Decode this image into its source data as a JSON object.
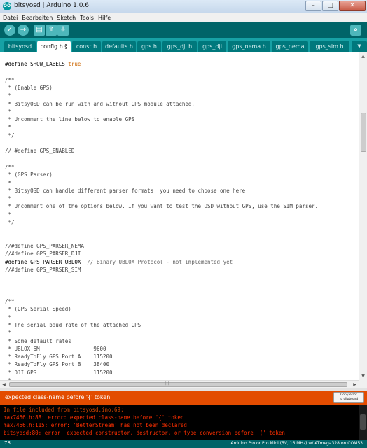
{
  "window": {
    "title": "bitsyosd | Arduino 1.0.6",
    "app_icon_text": "OO",
    "controls": [
      "–",
      "□",
      "✕"
    ]
  },
  "menu": [
    "Datei",
    "Bearbeiten",
    "Sketch",
    "Tools",
    "Hilfe"
  ],
  "toolbar": {
    "buttons": [
      "verify-icon",
      "upload-icon",
      "new-icon",
      "open-icon",
      "save-icon"
    ],
    "glyphs": {
      "verify": "✓",
      "upload": "→",
      "new": "▤",
      "open": "⇧",
      "save": "⇩",
      "serial": "⌕"
    },
    "serial_monitor_icon": "magnifier-icon",
    "accent_color": "#006468"
  },
  "tabs": {
    "items": [
      "bitsyosd",
      "config.h §",
      "const.h",
      "defaults.h",
      "gps.h",
      "gps_dji.h",
      "gps_dji",
      "gps_nema.h",
      "gps_nema",
      "gps_sim.h"
    ],
    "active_index": 1,
    "overflow_label": "▼"
  },
  "code": {
    "lines": [
      {
        "row": 1,
        "text": "#define SHOW_LABELS",
        "value": " true"
      },
      {
        "row": 3,
        "text": "/**"
      },
      {
        "row": 4,
        "text": " * (Enable GPS)"
      },
      {
        "row": 5,
        "text": " *"
      },
      {
        "row": 6,
        "text": " * BitsyOSD can be run with and without GPS module attached."
      },
      {
        "row": 7,
        "text": " *"
      },
      {
        "row": 8,
        "text": " * Uncomment the line below to enable GPS"
      },
      {
        "row": 9,
        "text": " *"
      },
      {
        "row": 10,
        "text": " */"
      },
      {
        "row": 12,
        "text": "// #define GPS_ENABLED"
      },
      {
        "row": 14,
        "text": "/**"
      },
      {
        "row": 15,
        "text": " * (GPS Parser)"
      },
      {
        "row": 16,
        "text": " *"
      },
      {
        "row": 17,
        "text": " * BitsyOSD can handle different parser formats, you need to choose one here"
      },
      {
        "row": 18,
        "text": " *"
      },
      {
        "row": 19,
        "text": " * Uncomment one of the options below. If you want to test the OSD without GPS, use the SIM parser."
      },
      {
        "row": 20,
        "text": " *"
      },
      {
        "row": 21,
        "text": " */"
      },
      {
        "row": 24,
        "text": "//#define GPS_PARSER_NEMA"
      },
      {
        "row": 25,
        "text": "//#define GPS_PARSER_DJI"
      },
      {
        "row": 26,
        "text": "#define GPS_PARSER_UBLOX",
        "comment": "  // Binary UBLOX Protocol - not implemented yet"
      },
      {
        "row": 27,
        "text": "//#define GPS_PARSER_SIM"
      },
      {
        "row": 31,
        "text": "/**"
      },
      {
        "row": 32,
        "text": " * (GPS Serial Speed)"
      },
      {
        "row": 33,
        "text": " *"
      },
      {
        "row": 34,
        "text": " * The serial baud rate of the attached GPS"
      },
      {
        "row": 35,
        "text": " *"
      },
      {
        "row": 36,
        "text": " * Some default rates"
      },
      {
        "row": 37,
        "text": " * UBLOX 6M                 9600"
      },
      {
        "row": 38,
        "text": " * ReadyToFly GPS Port A    115200"
      },
      {
        "row": 39,
        "text": " * ReadyToFly GPS Port B    38400"
      },
      {
        "row": 40,
        "text": " * DJI GPS                  115200"
      },
      {
        "row": 41,
        "text": " *"
      },
      {
        "row": 42,
        "text": " */"
      }
    ]
  },
  "scrollbars": {
    "vertical_arrows": [
      "▲",
      "▼"
    ],
    "horizontal_arrows": [
      "◀",
      "▶"
    ],
    "grip": "|||"
  },
  "message": {
    "text": "expected class-name before '{' token",
    "copy_button_line1": "Copy error",
    "copy_button_line2": "to clipboard",
    "color": "#e34c00"
  },
  "console": {
    "lines": [
      "In file included from bitsyosd.ino:69:",
      "max7456.h:88: error: expected class-name before '{' token",
      "max7456.h:115: error: 'BetterStream' has not been declared",
      "bitsyosd:80: error: expected constructor, destructor, or type conversion before '(' token"
    ]
  },
  "status": {
    "line_number": "78",
    "board": "Arduino Pro or Pro Mini (5V, 16 MHz) w/ ATmega328 on COM53"
  }
}
